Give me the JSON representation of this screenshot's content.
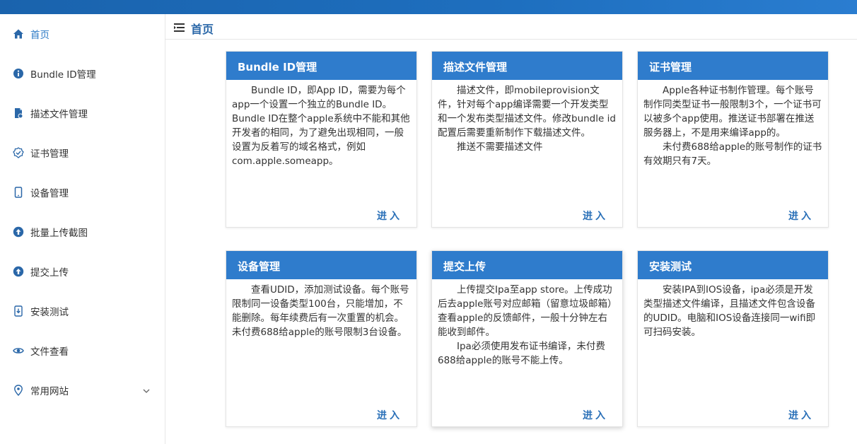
{
  "sidebar": {
    "items": [
      {
        "label": "首页",
        "icon": "home-icon"
      },
      {
        "label": "Bundle ID管理",
        "icon": "info-icon"
      },
      {
        "label": "描述文件管理",
        "icon": "file-icon"
      },
      {
        "label": "证书管理",
        "icon": "certificate-icon"
      },
      {
        "label": "设备管理",
        "icon": "phone-icon"
      },
      {
        "label": "批量上传截图",
        "icon": "upload-icon"
      },
      {
        "label": "提交上传",
        "icon": "upload-icon"
      },
      {
        "label": "安装测试",
        "icon": "install-icon"
      },
      {
        "label": "文件查看",
        "icon": "eye-icon"
      },
      {
        "label": "常用网站",
        "icon": "location-icon"
      }
    ]
  },
  "header": {
    "title": "首页",
    "menu_icon": "menu-icon"
  },
  "cards": [
    {
      "title": "Bundle ID管理",
      "paragraphs": [
        "Bundle ID，即App ID，需要为每个app一个设置一个独立的Bundle ID。Bundle ID在整个apple系统中不能和其他开发者的相同，为了避免出现相同，一般设置为反着写的域名格式，例如com.apple.someapp。"
      ],
      "enter": "进入"
    },
    {
      "title": "描述文件管理",
      "paragraphs": [
        "描述文件，即mobileprovision文件，针对每个app编译需要一个开发类型和一个发布类型描述文件。修改bundle id配置后需要重新制作下载描述文件。",
        "推送不需要描述文件"
      ],
      "enter": "进入"
    },
    {
      "title": "证书管理",
      "paragraphs": [
        "Apple各种证书制作管理。每个账号制作同类型证书一般限制3个，一个证书可以被多个app使用。推送证书部署在推送服务器上，不是用来编译app的。",
        "未付费688给apple的账号制作的证书有效期只有7天。"
      ],
      "enter": "进入"
    },
    {
      "title": "设备管理",
      "paragraphs": [
        "查看UDID，添加测试设备。每个账号限制同一设备类型100台，只能增加，不能删除。每年续费后有一次重置的机会。未付费688给apple的账号限制3台设备。"
      ],
      "enter": "进入"
    },
    {
      "title": "提交上传",
      "paragraphs": [
        "上传提交Ipa至app store。上传成功后去apple账号对应邮箱（留意垃圾邮箱）查看apple的反馈邮件，一般十分钟左右能收到邮件。",
        "Ipa必须使用发布证书编译，未付费688给apple的账号不能上传。"
      ],
      "enter": "进入"
    },
    {
      "title": "安装测试",
      "paragraphs": [
        "安装IPA到IOS设备，ipa必须是开发类型描述文件编译，且描述文件包含设备的UDID。电脑和IOS设备连接同一wifi即可扫码安装。"
      ],
      "enter": "进入"
    }
  ],
  "colors": {
    "accent": "#2f7ccc",
    "topbar": "#1e6fbf",
    "active": "#2a78c5"
  }
}
